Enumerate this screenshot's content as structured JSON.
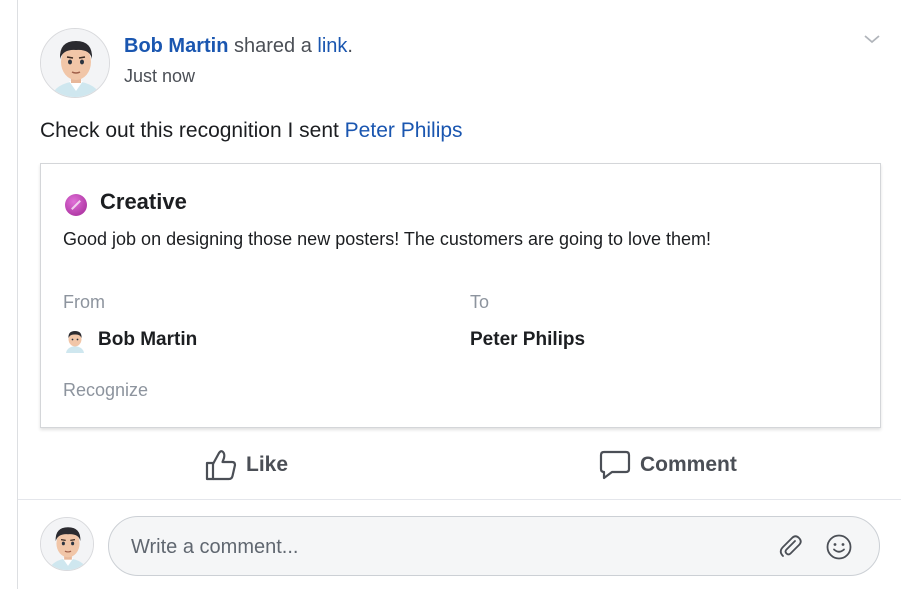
{
  "post": {
    "author": "Bob Martin",
    "shared_text": " shared a ",
    "link_text": "link",
    "period": ".",
    "time": "Just now",
    "message_prefix": "Check out this recognition I sent ",
    "mention": "Peter Philips"
  },
  "card": {
    "title": "Creative",
    "body": "Good job on designing those new posters! The customers are going to love them!",
    "from_label": "From",
    "to_label": "To",
    "from_name": "Bob Martin",
    "to_name": "Peter Philips",
    "recognize_label": "Recognize",
    "badge_color": "#c24cb8"
  },
  "actions": {
    "like_label": "Like",
    "comment_label": "Comment"
  },
  "composer": {
    "placeholder": "Write a comment..."
  },
  "colors": {
    "link": "#1a56b0",
    "muted": "#8d949e"
  },
  "icons": [
    "chevron-down-icon",
    "like-icon",
    "comment-icon",
    "paperclip-icon",
    "smiley-icon"
  ]
}
